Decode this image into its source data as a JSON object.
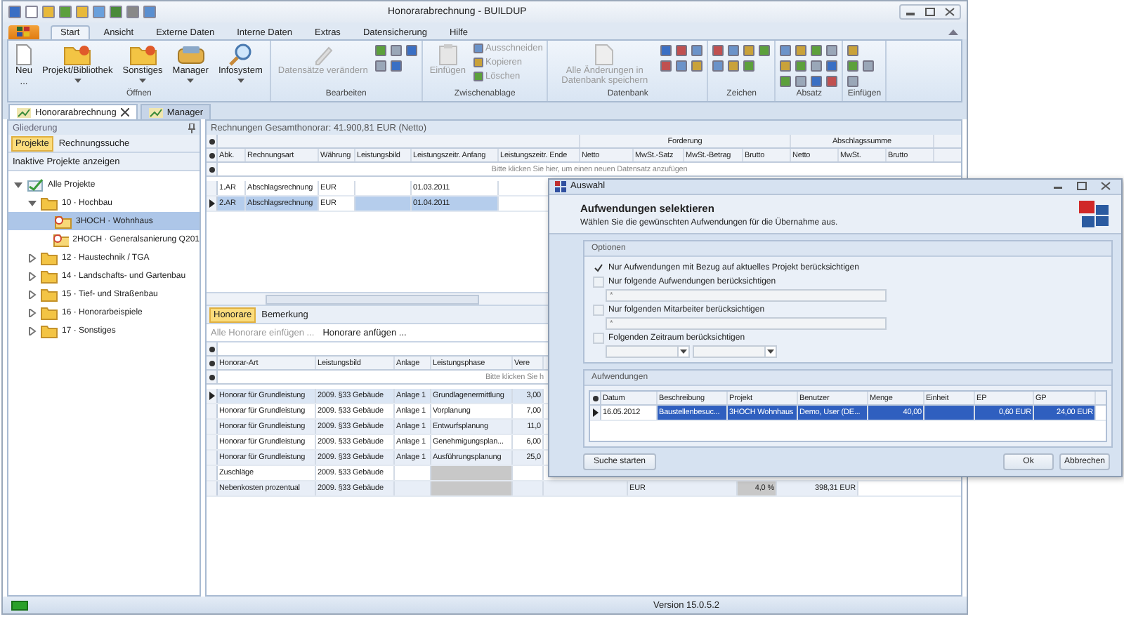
{
  "window": {
    "title": "Honorarabrechnung - BUILDUP"
  },
  "ribbon_tabs": [
    {
      "label": "Start",
      "selected": true
    },
    {
      "label": "Ansicht",
      "selected": false
    },
    {
      "label": "Externe Daten",
      "selected": false
    },
    {
      "label": "Interne Daten",
      "selected": false
    },
    {
      "label": "Extras",
      "selected": false
    },
    {
      "label": "Datensicherung",
      "selected": false
    },
    {
      "label": "Hilfe",
      "selected": false
    }
  ],
  "ribbon_groups": [
    {
      "label": "Öffnen",
      "large": [
        {
          "label": "Neu",
          "hint": "...",
          "disabled": false,
          "dropdown": false
        },
        {
          "label": "Projekt/Bibliothek",
          "disabled": false,
          "dropdown": true
        },
        {
          "label": "Sonstiges",
          "disabled": false,
          "dropdown": true
        },
        {
          "label": "Manager",
          "disabled": false,
          "dropdown": true
        },
        {
          "label": "Infosystem",
          "disabled": false,
          "dropdown": true
        }
      ]
    },
    {
      "label": "Bearbeiten",
      "large": [
        {
          "label": "Datensätze verändern",
          "disabled": true,
          "dropdown": false
        }
      ]
    },
    {
      "label": "Zwischenablage",
      "large": [
        {
          "label": "Einfügen",
          "disabled": true,
          "dropdown": false
        }
      ],
      "small": [
        {
          "label": "Ausschneiden",
          "disabled": true
        },
        {
          "label": "Kopieren",
          "disabled": true
        },
        {
          "label": "Löschen",
          "disabled": true
        }
      ]
    },
    {
      "label": "Datenbank",
      "large": [
        {
          "label": "Alle Änderungen in Datenbank speichern",
          "disabled": true,
          "dropdown": false
        }
      ]
    },
    {
      "label": "Zeichen"
    },
    {
      "label": "Absatz"
    },
    {
      "label": "Einfügen"
    }
  ],
  "doc_tabs": [
    {
      "label": "Honorarabrechnung",
      "selected": true,
      "closable": true
    },
    {
      "label": "Manager",
      "selected": false,
      "closable": false
    }
  ],
  "sidebar": {
    "title": "Gliederung",
    "tabs": [
      {
        "label": "Projekte",
        "selected": true
      },
      {
        "label": "Rechnungssuche",
        "selected": false
      }
    ],
    "toggle": "Inaktive Projekte anzeigen",
    "tree": [
      {
        "label": "Alle Projekte",
        "kind": "root",
        "expanded": true,
        "selected": false,
        "children": [
          {
            "label": "10 · Hochbau",
            "kind": "folder",
            "expanded": true,
            "selected": false,
            "children": [
              {
                "label": "3HOCH · Wohnhaus",
                "kind": "project",
                "selected": true
              },
              {
                "label": "2HOCH · Generalsanierung Q201",
                "kind": "project",
                "selected": false
              }
            ]
          },
          {
            "label": "12 · Haustechnik / TGA",
            "kind": "folder",
            "expanded": false,
            "selected": false
          },
          {
            "label": "14 · Landschafts- und Gartenbau",
            "kind": "folder",
            "expanded": false,
            "selected": false
          },
          {
            "label": "15 · Tief- und Straßenbau",
            "kind": "folder",
            "expanded": false,
            "selected": false
          },
          {
            "label": "16 · Honorarbeispiele",
            "kind": "folder",
            "expanded": false,
            "selected": false
          },
          {
            "label": "17 · Sonstiges",
            "kind": "folder",
            "expanded": false,
            "selected": false
          }
        ]
      }
    ]
  },
  "invoices": {
    "summary": "Rechnungen Gesamthonorar: 41.900,81 EUR (Netto)",
    "columns": [
      "Abk.",
      "Rechnungsart",
      "Währung",
      "Leistungsbild",
      "Leistungszeitr. Anfang",
      "Leistungszeitr. Ende"
    ],
    "bands": [
      {
        "label": "Forderung",
        "columns": [
          "Netto",
          "MwSt.-Satz",
          "MwSt.-Betrag",
          "Brutto"
        ]
      },
      {
        "label": "Abschlagssumme",
        "columns": [
          "Netto",
          "MwSt.",
          "Brutto"
        ]
      }
    ],
    "new_row_hint": "Bitte klicken Sie hier, um einen neuen Datensatz anzufügen",
    "rows": [
      {
        "abk": "1.AR",
        "art": "Abschlagsrechnung",
        "currency": "EUR",
        "start": "01.03.2011",
        "selected": false
      },
      {
        "abk": "2.AR",
        "art": "Abschlagsrechnung",
        "currency": "EUR",
        "start": "01.04.2011",
        "selected": true
      }
    ]
  },
  "fees": {
    "tabs": [
      {
        "label": "Honorare",
        "selected": true
      },
      {
        "label": "Bemerkung",
        "selected": false
      }
    ],
    "actions": [
      {
        "label": "Alle Honorare einfügen ...",
        "disabled": true
      },
      {
        "label": "Honorare anfügen ...",
        "disabled": false
      }
    ],
    "columns": [
      "Honorar-Art",
      "Leistungsbild",
      "Anlage",
      "Leistungsphase",
      "Vere"
    ],
    "new_row_hint": "Bitte klicken Sie h",
    "rows": [
      {
        "art": "Honorar für Grundleistung",
        "bild": "2009. §33 Gebäude",
        "anlage": "Anlage 1",
        "phase": "Grundlagenermittlung",
        "value": "3,00",
        "selected": true
      },
      {
        "art": "Honorar für Grundleistung",
        "bild": "2009. §33 Gebäude",
        "anlage": "Anlage 1",
        "phase": "Vorplanung",
        "value": "7,00",
        "selected": false
      },
      {
        "art": "Honorar für Grundleistung",
        "bild": "2009. §33 Gebäude",
        "anlage": "Anlage 1",
        "phase": "Entwurfsplanung",
        "value": "11,0",
        "selected": false
      },
      {
        "art": "Honorar für Grundleistung",
        "bild": "2009. §33 Gebäude",
        "anlage": "Anlage 1",
        "phase": "Genehmigungsplan...",
        "value": "6,00",
        "selected": false
      },
      {
        "art": "Honorar für Grundleistung",
        "bild": "2009. §33 Gebäude",
        "anlage": "Anlage 1",
        "phase": "Ausführungsplanung",
        "value": "25,0",
        "selected": false
      },
      {
        "art": "Zuschläge",
        "bild": "2009. §33 Gebäude",
        "selected": false
      },
      {
        "art": "Nebenkosten prozentual",
        "bild": "2009. §33 Gebäude",
        "currency": "EUR",
        "percent": "4,0 %",
        "amount": "398,31 EUR",
        "selected": false
      }
    ]
  },
  "status_bar": {
    "version": "Version 15.0.5.2"
  },
  "dialog": {
    "title": "Auswahl",
    "heading": "Aufwendungen selektieren",
    "subtitle": "Wählen Sie die gewünschten Aufwendungen für die Übernahme aus.",
    "options_title": "Optionen",
    "options": [
      {
        "label": "Nur Aufwendungen mit Bezug auf aktuelles Projekt berücksichtigen",
        "kind": "plain",
        "checked": true
      },
      {
        "label": "Nur folgende Aufwendungen berücksichtigen",
        "kind": "text",
        "checked": false,
        "placeholder": "*"
      },
      {
        "label": "Nur folgenden Mitarbeiter berücksichtigen",
        "kind": "text",
        "checked": false,
        "placeholder": "*"
      },
      {
        "label": "Folgenden Zeitraum berücksichtigen",
        "kind": "daterange",
        "checked": false
      }
    ],
    "list_title": "Aufwendungen",
    "columns": [
      "Datum",
      "Beschreibung",
      "Projekt",
      "Benutzer",
      "Menge",
      "Einheit",
      "EP",
      "GP"
    ],
    "rows": [
      {
        "datum": "16.05.2012",
        "beschreibung": "Baustellenbesuc...",
        "projekt": "3HOCH Wohnhaus",
        "benutzer": "Demo, User (DE...",
        "menge": "40,00",
        "ep": "0,60 EUR",
        "gp": "24,00 EUR",
        "selected": true
      }
    ],
    "search_button": "Suche starten",
    "ok_button": "Ok",
    "cancel_button": "Abbrechen"
  }
}
